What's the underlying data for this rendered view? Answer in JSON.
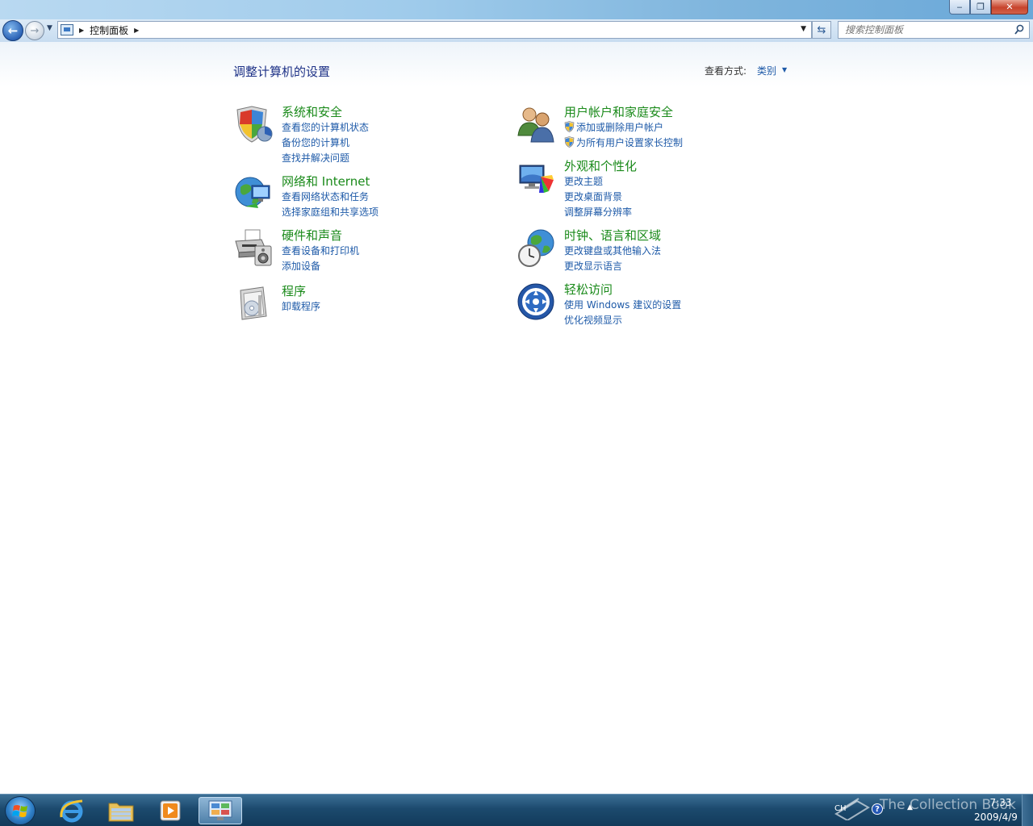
{
  "window": {
    "minimize_glyph": "‒",
    "maximize_glyph": "❐",
    "close_glyph": "✕"
  },
  "nav": {
    "back_glyph": "←",
    "forward_glyph": "→",
    "address_crumb": "控制面板",
    "search_placeholder": "搜索控制面板"
  },
  "header": {
    "title": "调整计算机的设置",
    "view_by_label": "查看方式:",
    "view_by_value": "类别"
  },
  "categories": [
    {
      "icon": "security-shield-icon",
      "title": "系统和安全",
      "links": [
        "查看您的计算机状态",
        "备份您的计算机",
        "查找并解决问题"
      ]
    },
    {
      "icon": "network-globe-icon",
      "title": "网络和 Internet",
      "links": [
        "查看网络状态和任务",
        "选择家庭组和共享选项"
      ]
    },
    {
      "icon": "printer-icon",
      "title": "硬件和声音",
      "links": [
        "查看设备和打印机",
        "添加设备"
      ]
    },
    {
      "icon": "programs-icon",
      "title": "程序",
      "links": [
        "卸载程序"
      ]
    },
    {
      "icon": "users-icon",
      "title": "用户帐户和家庭安全",
      "links": [
        "添加或删除用户帐户",
        "为所有用户设置家长控制"
      ]
    },
    {
      "icon": "appearance-icon",
      "title": "外观和个性化",
      "links": [
        "更改主题",
        "更改桌面背景",
        "调整屏幕分辨率"
      ]
    },
    {
      "icon": "clock-globe-icon",
      "title": "时钟、语言和区域",
      "links": [
        "更改键盘或其他输入法",
        "更改显示语言"
      ]
    },
    {
      "icon": "ease-of-access-icon",
      "title": "轻松访问",
      "links": [
        "使用 Windows 建议的设置",
        "优化视频显示"
      ]
    }
  ],
  "taskbar": {
    "apps": [
      "internet-explorer-icon",
      "file-explorer-icon",
      "media-player-icon",
      "control-panel-icon"
    ],
    "tray": {
      "language": "CH",
      "help_glyph": "?",
      "expand_glyph": "▲",
      "time": "7:33",
      "date": "2009/4/9",
      "watermark": "The Collection Book"
    }
  },
  "colors": {
    "category_title": "#1a8a1a",
    "link": "#1e5aa8",
    "page_title": "#1e3287",
    "taskbar": "#1c4a6e"
  }
}
